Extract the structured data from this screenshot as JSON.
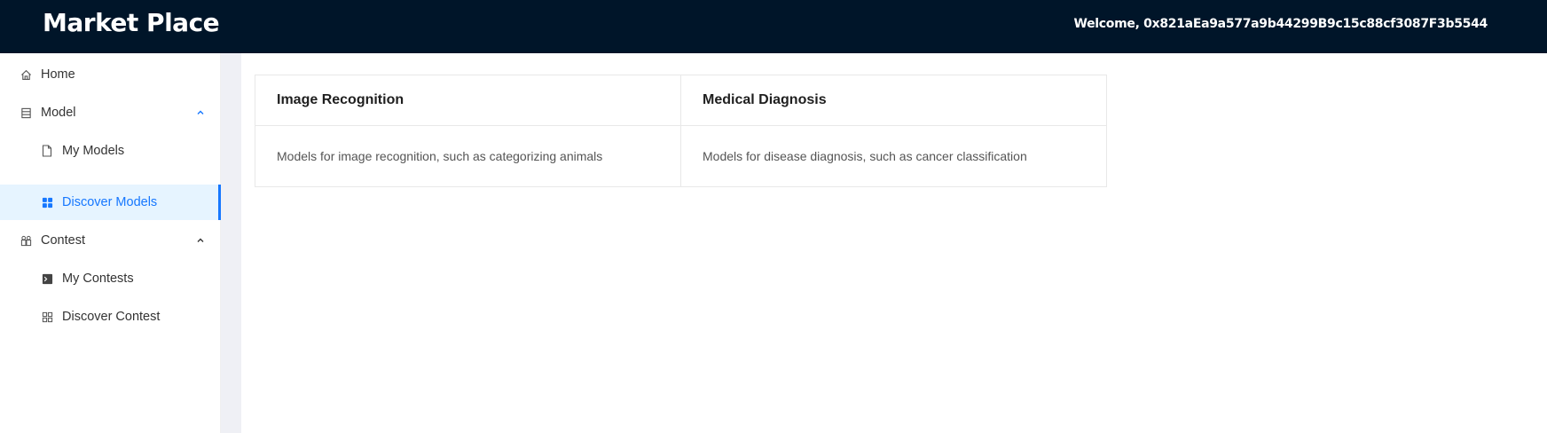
{
  "header": {
    "title": "Market Place",
    "welcome": "Welcome, 0x821aEa9a577a9b44299B9c15c88cf3087F3b5544"
  },
  "sidebar": {
    "items": [
      {
        "label": "Home",
        "icon": "home-icon"
      },
      {
        "label": "Model",
        "icon": "model-icon",
        "expanded": true
      },
      {
        "label": "My Models",
        "icon": "file-icon"
      },
      {
        "label": "Discover Models",
        "icon": "apps-icon",
        "selected": true
      },
      {
        "label": "Contest",
        "icon": "contest-icon",
        "expanded": true
      },
      {
        "label": "My Contests",
        "icon": "terminal-icon"
      },
      {
        "label": "Discover Contest",
        "icon": "grid-icon"
      }
    ]
  },
  "cards": [
    {
      "title": "Image Recognition",
      "description": "Models for image recognition, such as categorizing animals"
    },
    {
      "title": "Medical Diagnosis",
      "description": "Models for disease diagnosis, such as cancer classification"
    }
  ],
  "colors": {
    "header_bg": "#001529",
    "accent": "#1677ff",
    "selected_bg": "#e6f4ff"
  }
}
